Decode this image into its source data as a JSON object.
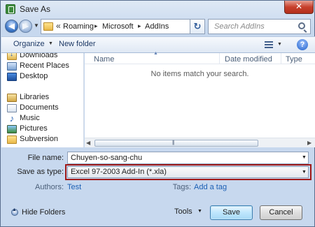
{
  "window": {
    "title": "Save As",
    "close_glyph": "✕"
  },
  "nav": {
    "back_glyph": "◀",
    "forward_glyph": "▶",
    "address": {
      "prefix": "«",
      "crumbs": [
        "Roaming",
        "Microsoft",
        "AddIns"
      ],
      "separator": "▸",
      "dropdown_glyph": "▼"
    },
    "refresh_glyph": "↻",
    "search": {
      "placeholder": "Search AddIns"
    }
  },
  "toolbar": {
    "organize_label": "Organize",
    "new_folder_label": "New folder",
    "dropdown_glyph": "▼",
    "help_glyph": "?"
  },
  "sidebar": {
    "items": [
      {
        "label": "Downloads",
        "icon": "downloads-icon"
      },
      {
        "label": "Recent Places",
        "icon": "recent-places-icon"
      },
      {
        "label": "Desktop",
        "icon": "desktop-icon"
      },
      {
        "label": "Libraries",
        "icon": "libraries-icon"
      },
      {
        "label": "Documents",
        "icon": "documents-icon"
      },
      {
        "label": "Music",
        "icon": "music-icon"
      },
      {
        "label": "Pictures",
        "icon": "pictures-icon"
      },
      {
        "label": "Subversion",
        "icon": "subversion-icon"
      }
    ]
  },
  "filelist": {
    "columns": [
      "Name",
      "Date modified",
      "Type"
    ],
    "sort_glyph": "▲",
    "empty_message": "No items match your search.",
    "scroll_grip": "|||"
  },
  "form": {
    "file_name_label": "File name:",
    "file_name_value": "Chuyen-so-sang-chu",
    "save_type_label": "Save as type:",
    "save_type_value": "Excel 97-2003 Add-In (*.xla)",
    "authors_label": "Authors:",
    "authors_value": "Test",
    "tags_label": "Tags:",
    "tags_value": "Add a tag"
  },
  "footer": {
    "hide_folders_label": "Hide Folders",
    "tools_label": "Tools",
    "save_label": "Save",
    "cancel_label": "Cancel"
  },
  "colors": {
    "accent": "#1b5fb4",
    "highlight_outline": "#a01919",
    "close_button": "#c7402c"
  }
}
